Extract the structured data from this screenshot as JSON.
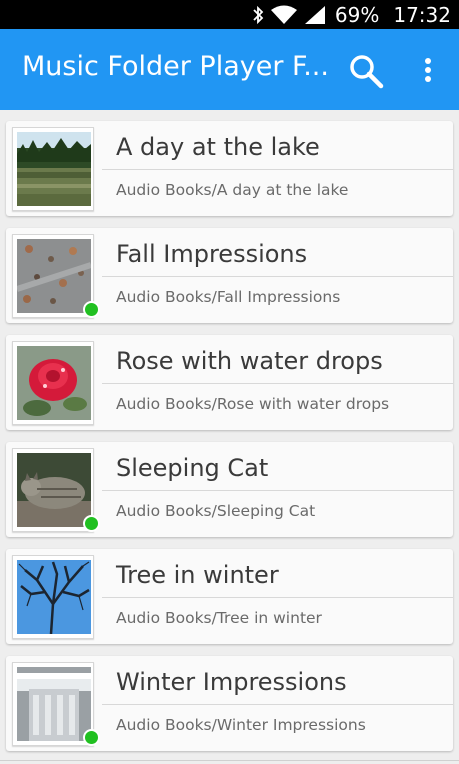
{
  "status_bar": {
    "battery": "69%",
    "time": "17:32",
    "icons": [
      "bluetooth-icon",
      "wifi-icon",
      "signal-icon"
    ]
  },
  "app_bar": {
    "title": "Music Folder Player F...",
    "actions": [
      "search-icon",
      "more-vert-icon"
    ],
    "color": "#2196f3"
  },
  "folders": [
    {
      "title": "A day at the lake",
      "path": "Audio Books/A day at the lake",
      "playing": false,
      "image": "lake"
    },
    {
      "title": "Fall Impressions",
      "path": "Audio Books/Fall Impressions",
      "playing": true,
      "image": "leaves"
    },
    {
      "title": "Rose with water drops",
      "path": "Audio Books/Rose with water drops",
      "playing": false,
      "image": "rose"
    },
    {
      "title": "Sleeping Cat",
      "path": "Audio Books/Sleeping Cat",
      "playing": true,
      "image": "cat"
    },
    {
      "title": "Tree in winter",
      "path": "Audio Books/Tree in winter",
      "playing": false,
      "image": "tree"
    },
    {
      "title": "Winter Impressions",
      "path": "Audio Books/Winter Impressions",
      "playing": true,
      "image": "winter"
    }
  ],
  "colors": {
    "playing_indicator": "#21c021",
    "background": "#eeeeee"
  }
}
